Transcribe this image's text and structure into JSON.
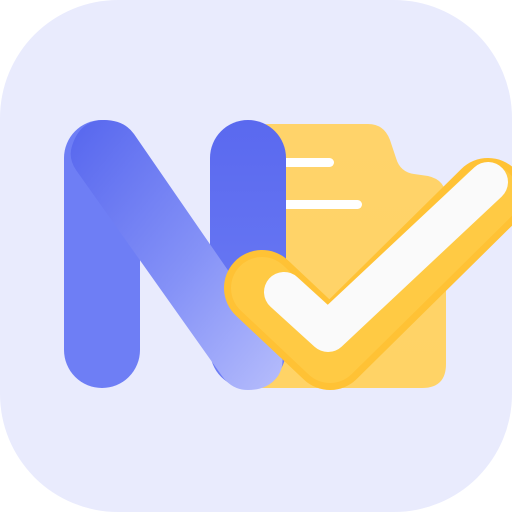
{
  "app_icon": {
    "icon": "note-check-app-icon",
    "colors": {
      "tile_background": "#E9EBFD",
      "letter_blue_dark": "#5666EE",
      "letter_blue_mid": "#6E7EF5",
      "letter_blue_light": "#AEB6FC",
      "document_yellow": "#FFD366",
      "document_yellow_dark": "#FFC53D",
      "document_lines": "#FFFFFF",
      "check_white": "#FAFAFA",
      "check_outline": "#FFC235"
    }
  }
}
